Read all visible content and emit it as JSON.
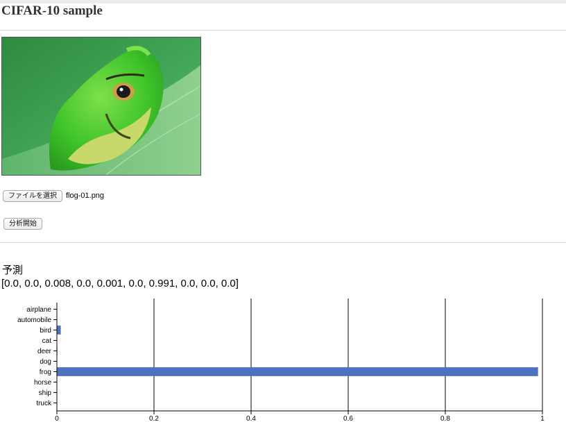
{
  "header": {
    "title": "CIFAR-10 sample"
  },
  "preview": {
    "image_icon": "frog-photo",
    "alt": "frog"
  },
  "file_input": {
    "button_label": "ファイルを選択",
    "filename": "flog-01.png"
  },
  "analyze": {
    "button_label": "分析開始"
  },
  "prediction": {
    "heading": "予測",
    "values_text": "[0.0, 0.0, 0.008, 0.0, 0.001, 0.0, 0.991, 0.0, 0.0, 0.0]"
  },
  "chart_data": {
    "type": "bar",
    "orientation": "horizontal",
    "categories": [
      "airplane",
      "automobile",
      "bird",
      "cat",
      "deer",
      "dog",
      "frog",
      "horse",
      "ship",
      "truck"
    ],
    "values": [
      0.0,
      0.0,
      0.008,
      0.0,
      0.001,
      0.0,
      0.991,
      0.0,
      0.0,
      0.0
    ],
    "xlim": [
      0,
      1
    ],
    "xticks": [
      0,
      0.2,
      0.4,
      0.6,
      0.8,
      1
    ],
    "grid": true,
    "bar_color": "#4e72bd"
  }
}
